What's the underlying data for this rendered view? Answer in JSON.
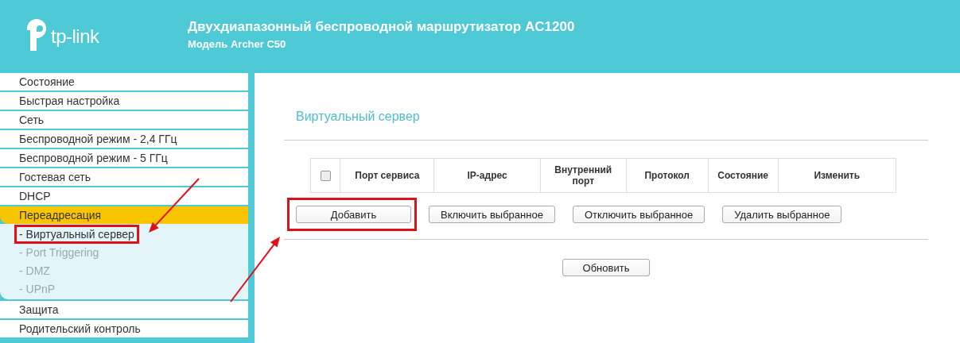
{
  "header": {
    "logo_text": "tp-link",
    "title": "Двухдиапазонный беспроводной маршрутизатор AC1200",
    "subtitle": "Модель Archer C50"
  },
  "sidebar": {
    "items": [
      {
        "label": "Состояние",
        "selected": false
      },
      {
        "label": "Быстрая настройка",
        "selected": false
      },
      {
        "label": "Сеть",
        "selected": false
      },
      {
        "label": "Беспроводной режим - 2,4 ГГц",
        "selected": false
      },
      {
        "label": "Беспроводной режим - 5 ГГц",
        "selected": false
      },
      {
        "label": "Гостевая сеть",
        "selected": false
      },
      {
        "label": "DHCP",
        "selected": false
      },
      {
        "label": "Переадресация",
        "selected": true,
        "children": [
          {
            "label": "- Виртуальный сервер",
            "selected": true,
            "highlighted": true
          },
          {
            "label": "- Port Triggering",
            "selected": false,
            "highlighted": false
          },
          {
            "label": "- DMZ",
            "selected": false,
            "highlighted": false
          },
          {
            "label": "- UPnP",
            "selected": false,
            "highlighted": false
          }
        ]
      },
      {
        "label": "Защита",
        "selected": false
      },
      {
        "label": "Родительский контроль",
        "selected": false
      }
    ]
  },
  "content": {
    "title": "Виртуальный сервер",
    "table": {
      "select_all": {
        "checked": false
      },
      "columns": [
        "Порт сервиса",
        "IP-адрес",
        "Внутренний порт",
        "Протокол",
        "Состояние",
        "Изменить"
      ]
    },
    "buttons": [
      {
        "label": "Добавить",
        "highlighted": true
      },
      {
        "label": "Включить выбранное",
        "highlighted": false
      },
      {
        "label": "Отключить выбранное",
        "highlighted": false
      },
      {
        "label": "Удалить выбранное",
        "highlighted": false
      }
    ],
    "refresh_button": "Обновить"
  }
}
